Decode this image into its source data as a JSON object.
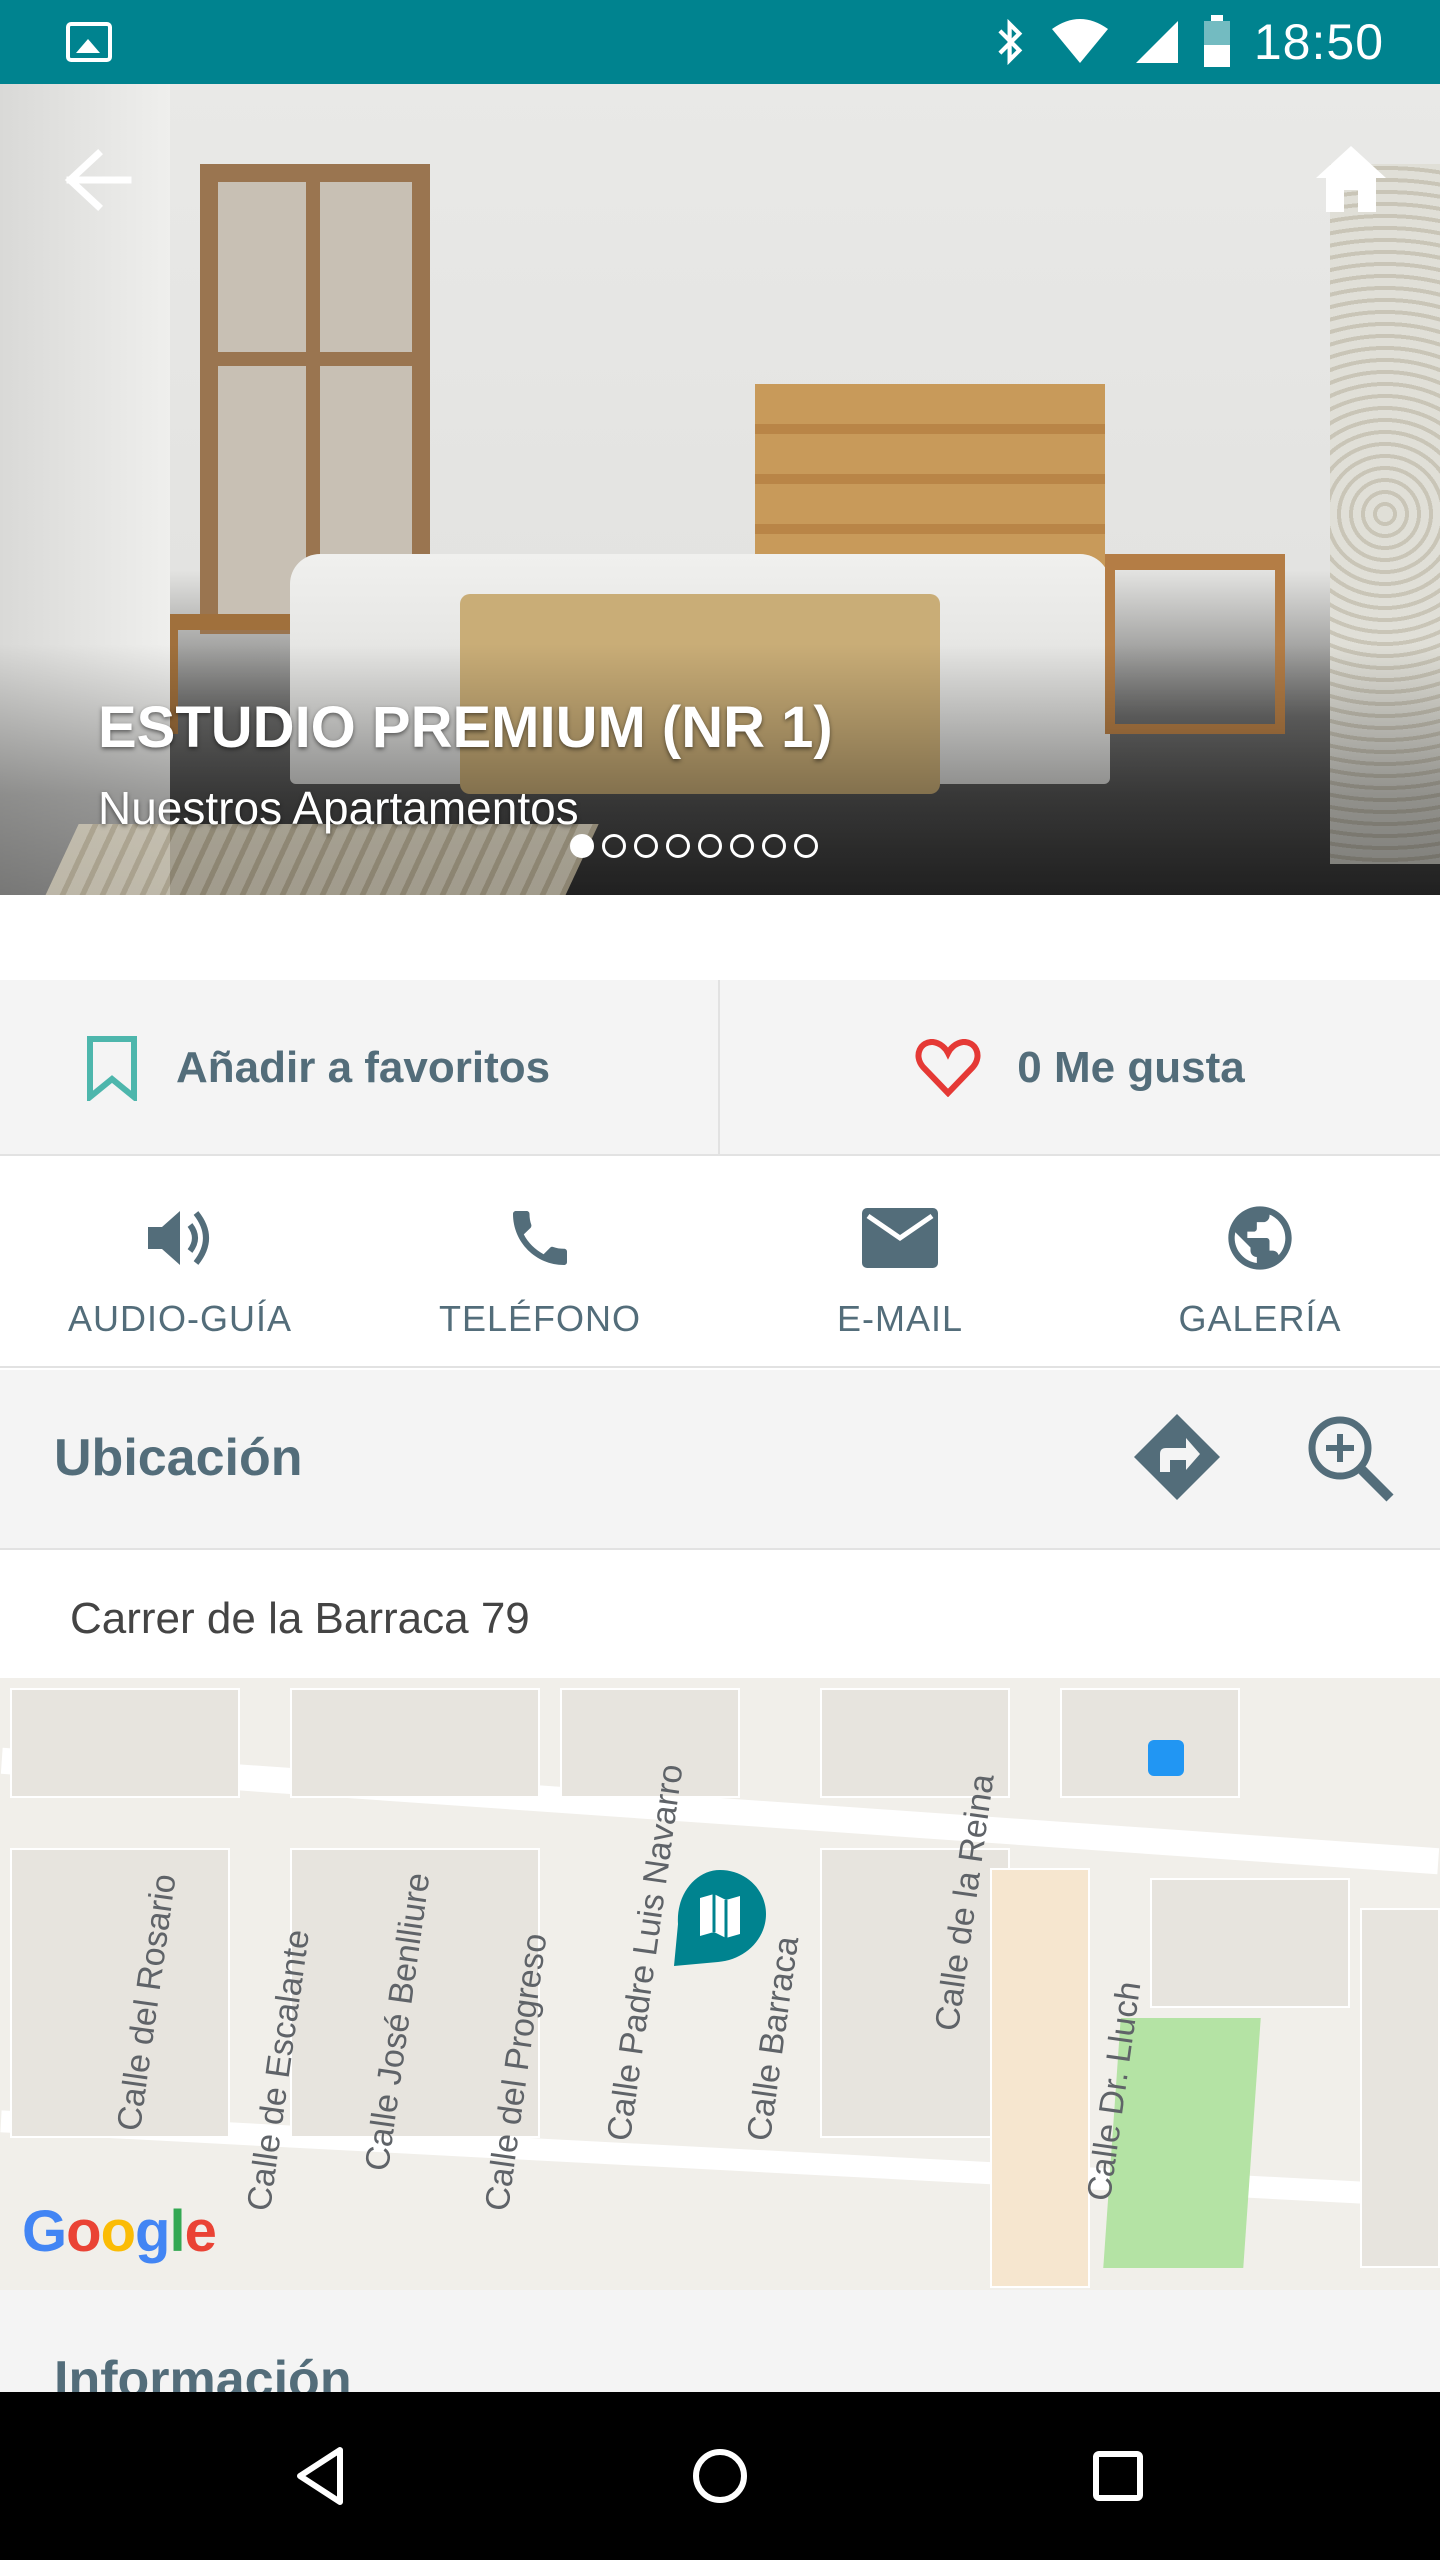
{
  "status_bar": {
    "time": "18:50",
    "icons": [
      "gallery-icon",
      "bluetooth-icon",
      "wifi-icon",
      "signal-icon",
      "battery-icon"
    ]
  },
  "hero": {
    "title": "ESTUDIO PREMIUM (NR 1)",
    "subtitle": "Nuestros Apartamentos",
    "slide_count": 8,
    "active_slide": 1
  },
  "actions": {
    "favorites_label": "Añadir a favoritos",
    "like_label": "0 Me gusta"
  },
  "contact": [
    {
      "label": "AUDIO-GUÍA",
      "icon": "speaker-icon"
    },
    {
      "label": "TELÉFONO",
      "icon": "phone-icon"
    },
    {
      "label": "E-MAIL",
      "icon": "mail-icon"
    },
    {
      "label": "GALERÍA",
      "icon": "globe-icon"
    }
  ],
  "location": {
    "title": "Ubicación",
    "address": "Carrer de la Barraca 79"
  },
  "map": {
    "streets": [
      "Calle del Rosario",
      "Calle de Escalante",
      "Calle José Benlliure",
      "Calle del Progreso",
      "Calle Padre Luis Navarro",
      "Calle Barraca",
      "Calle de la Reina",
      "Calle Dr. Lluch"
    ],
    "attribution": "Google"
  },
  "info": {
    "title": "Información"
  },
  "colors": {
    "status_bar": "#00838f",
    "text_accent": "#536d7a",
    "bookmark": "#4db6ac",
    "heart": "#e53935",
    "pin": "#00838f"
  }
}
